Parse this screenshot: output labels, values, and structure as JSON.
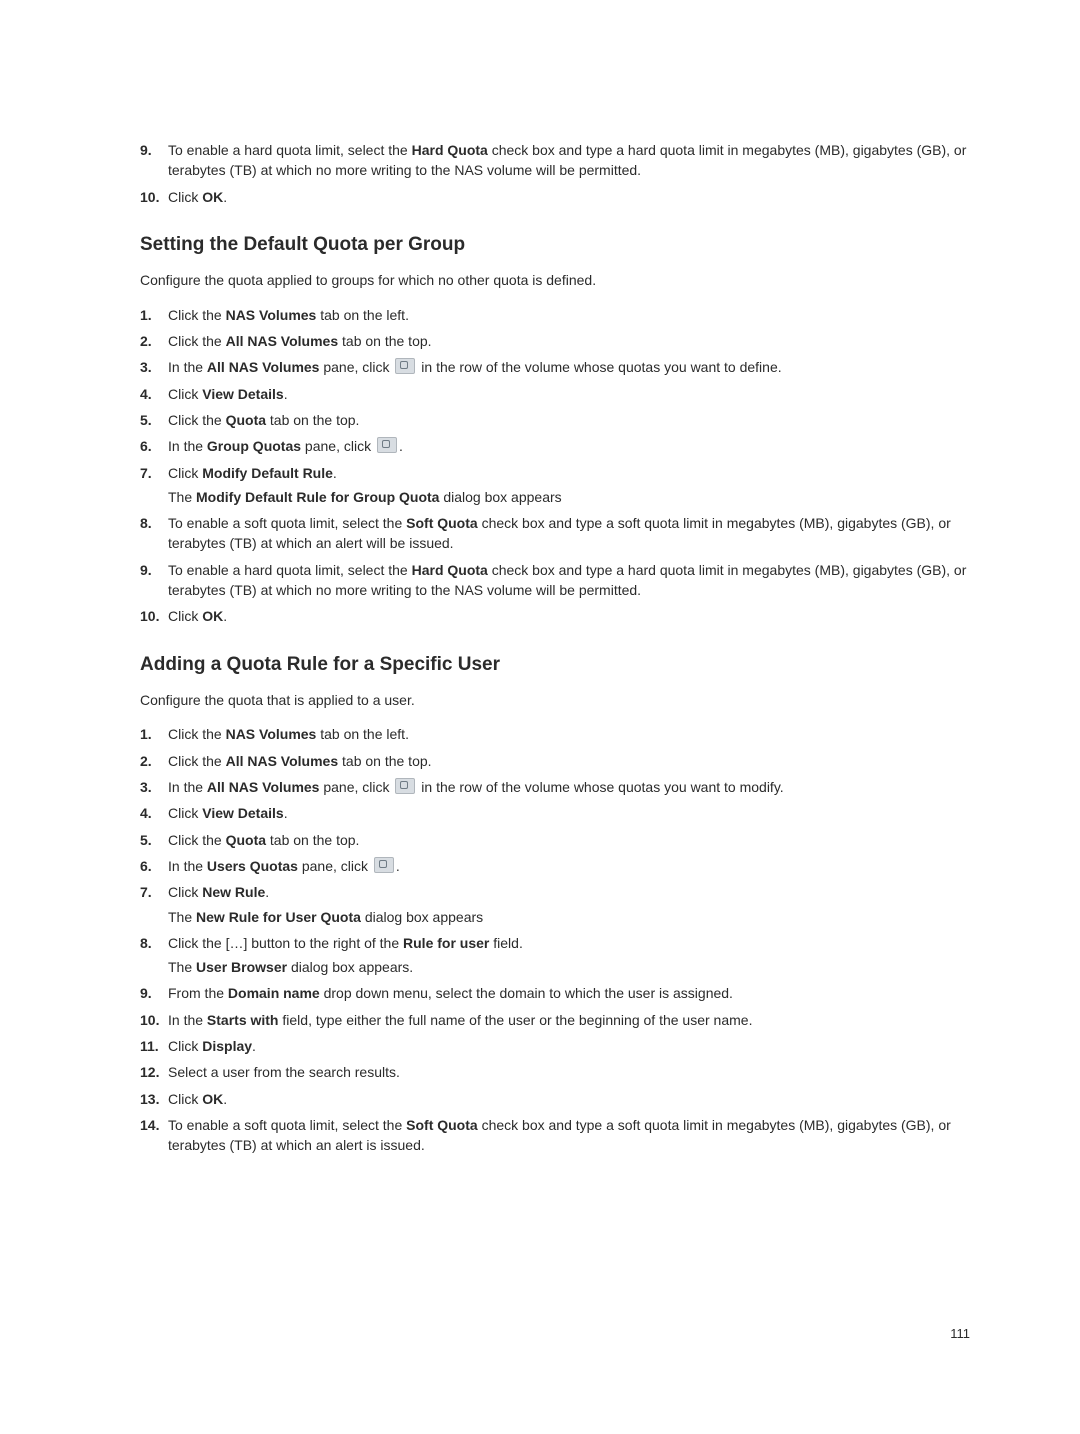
{
  "section0": {
    "items": [
      {
        "num": "9.",
        "text_before": "To enable a hard quota limit, select the ",
        "bold": "Hard Quota",
        "text_after": " check box and type a hard quota limit in megabytes (MB), gigabytes (GB), or terabytes (TB) at which no more writing to the NAS volume will be permitted."
      },
      {
        "num": "10.",
        "text_before": "Click ",
        "bold": "OK",
        "text_after": "."
      }
    ]
  },
  "heading1": "Setting the Default Quota per Group",
  "para1": "Configure the quota applied to groups for which no other quota is defined.",
  "section1": {
    "items": [
      {
        "num": "1.",
        "text_before": "Click the ",
        "bold": "NAS Volumes",
        "text_after": " tab on the left."
      },
      {
        "num": "2.",
        "text_before": "Click the ",
        "bold": "All NAS Volumes",
        "text_after": " tab on the top."
      },
      {
        "num": "3.",
        "text_before": "In the ",
        "bold": "All NAS Volumes",
        "text_mid": " pane, click ",
        "has_icon": true,
        "text_after": " in the row of the volume whose quotas you want to define."
      },
      {
        "num": "4.",
        "text_before": "Click ",
        "bold": "View Details",
        "text_after": "."
      },
      {
        "num": "5.",
        "text_before": "Click the ",
        "bold": "Quota",
        "text_after": " tab on the top."
      },
      {
        "num": "6.",
        "text_before": "In the ",
        "bold": "Group Quotas",
        "text_mid": " pane, click ",
        "has_icon": true,
        "text_after": "."
      },
      {
        "num": "7.",
        "text_before": "Click ",
        "bold": "Modify Default Rule",
        "text_after": ".",
        "sub_before": "The ",
        "sub_bold": "Modify Default Rule for Group Quota",
        "sub_after": " dialog box appears"
      },
      {
        "num": "8.",
        "text_before": "To enable a soft quota limit, select the ",
        "bold": "Soft Quota",
        "text_after": " check box and type a soft quota limit in megabytes (MB), gigabytes (GB), or terabytes (TB) at which an alert will be issued."
      },
      {
        "num": "9.",
        "text_before": "To enable a hard quota limit, select the ",
        "bold": "Hard Quota",
        "text_after": " check box and type a hard quota limit in megabytes (MB), gigabytes (GB), or terabytes (TB) at which no more writing to the NAS volume will be permitted."
      },
      {
        "num": "10.",
        "text_before": "Click ",
        "bold": "OK",
        "text_after": "."
      }
    ]
  },
  "heading2": "Adding a Quota Rule for a Specific User",
  "para2": "Configure the quota that is applied to a user.",
  "section2": {
    "items": [
      {
        "num": "1.",
        "text_before": "Click the ",
        "bold": "NAS Volumes",
        "text_after": " tab on the left."
      },
      {
        "num": "2.",
        "text_before": "Click the ",
        "bold": "All NAS Volumes",
        "text_after": " tab on the top."
      },
      {
        "num": "3.",
        "text_before": "In the ",
        "bold": "All NAS Volumes",
        "text_mid": " pane, click ",
        "has_icon": true,
        "text_after": " in the row of the volume whose quotas you want to modify."
      },
      {
        "num": "4.",
        "text_before": "Click ",
        "bold": "View Details",
        "text_after": "."
      },
      {
        "num": "5.",
        "text_before": "Click the ",
        "bold": "Quota",
        "text_after": " tab on the top."
      },
      {
        "num": "6.",
        "text_before": "In the ",
        "bold": "Users Quotas",
        "text_mid": " pane, click ",
        "has_icon": true,
        "text_after": "."
      },
      {
        "num": "7.",
        "text_before": "Click ",
        "bold": "New Rule",
        "text_after": ".",
        "sub_before": "The ",
        "sub_bold": "New Rule for User Quota",
        "sub_after": " dialog box appears"
      },
      {
        "num": "8.",
        "text_before": "Click the […] button to the right of the ",
        "bold": "Rule for user",
        "text_after": " field.",
        "sub_before": "The ",
        "sub_bold": "User Browser",
        "sub_after": " dialog box appears."
      },
      {
        "num": "9.",
        "text_before": "From the ",
        "bold": "Domain name",
        "text_after": " drop down menu, select the domain to which the user is assigned."
      },
      {
        "num": "10.",
        "text_before": "In the ",
        "bold": "Starts with",
        "text_after": " field, type either the full name of the user or the beginning of the user name."
      },
      {
        "num": "11.",
        "text_before": "Click ",
        "bold": "Display",
        "text_after": "."
      },
      {
        "num": "12.",
        "text_before": "Select a user from the search results.",
        "bold": "",
        "text_after": ""
      },
      {
        "num": "13.",
        "text_before": "Click ",
        "bold": "OK",
        "text_after": "."
      },
      {
        "num": "14.",
        "text_before": "To enable a soft quota limit, select the ",
        "bold": "Soft Quota",
        "text_after": " check box and type a soft quota limit in megabytes (MB), gigabytes (GB), or terabytes (TB) at which an alert is issued."
      }
    ]
  },
  "page_number": "111"
}
